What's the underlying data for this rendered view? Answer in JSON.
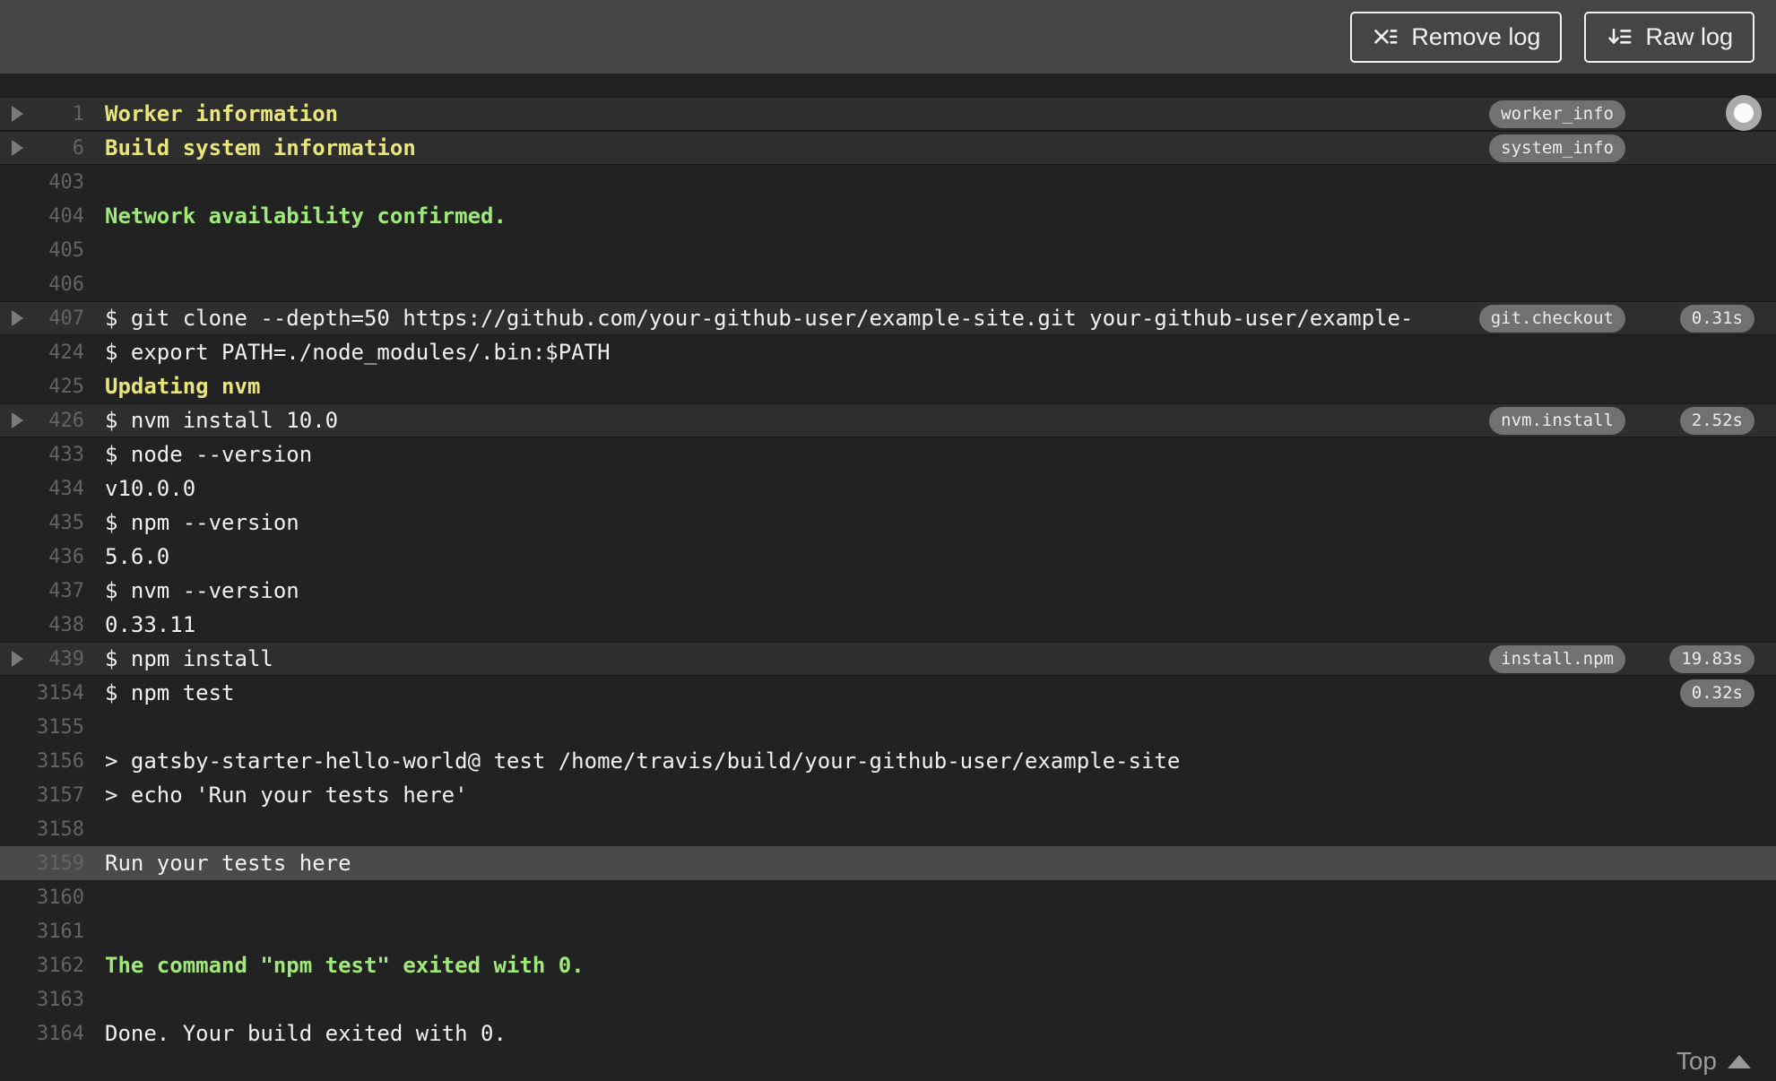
{
  "toolbar": {
    "remove_log_label": "Remove log",
    "raw_log_label": "Raw log"
  },
  "footer": {
    "top_label": "Top"
  },
  "colors": {
    "header_bg": "#454545",
    "log_bg": "#222222",
    "fold_bg": "#2e2e2e",
    "highlight_bg": "#4a4a4a",
    "text": "#f1f1ef",
    "yellow": "#e9e57e",
    "green": "#a0e87a",
    "line_number": "#646464",
    "badge_bg": "#717171",
    "badge_text": "#ececec"
  },
  "log": {
    "rows": [
      {
        "num": "1",
        "text": "Worker information",
        "color": "yellow",
        "bold": true,
        "fold": true,
        "badge": "worker_info",
        "duration": null,
        "highlight": false
      },
      {
        "num": "6",
        "text": "Build system information",
        "color": "yellow",
        "bold": true,
        "fold": true,
        "badge": "system_info",
        "duration": null,
        "highlight": false
      },
      {
        "num": "403",
        "text": "",
        "color": "plain",
        "bold": false,
        "fold": false,
        "badge": null,
        "duration": null,
        "highlight": false
      },
      {
        "num": "404",
        "text": "Network availability confirmed.",
        "color": "green",
        "bold": true,
        "fold": false,
        "badge": null,
        "duration": null,
        "highlight": false
      },
      {
        "num": "405",
        "text": "",
        "color": "plain",
        "bold": false,
        "fold": false,
        "badge": null,
        "duration": null,
        "highlight": false
      },
      {
        "num": "406",
        "text": "",
        "color": "plain",
        "bold": false,
        "fold": false,
        "badge": null,
        "duration": null,
        "highlight": false
      },
      {
        "num": "407",
        "text": "$ git clone --depth=50 https://github.com/your-github-user/example-site.git your-github-user/example-",
        "color": "plain",
        "bold": false,
        "fold": true,
        "badge": "git.checkout",
        "duration": "0.31s",
        "highlight": false
      },
      {
        "num": "424",
        "text": "$ export PATH=./node_modules/.bin:$PATH",
        "color": "plain",
        "bold": false,
        "fold": false,
        "badge": null,
        "duration": null,
        "highlight": false
      },
      {
        "num": "425",
        "text": "Updating nvm",
        "color": "yellow",
        "bold": true,
        "fold": false,
        "badge": null,
        "duration": null,
        "highlight": false
      },
      {
        "num": "426",
        "text": "$ nvm install 10.0",
        "color": "plain",
        "bold": false,
        "fold": true,
        "badge": "nvm.install",
        "duration": "2.52s",
        "highlight": false
      },
      {
        "num": "433",
        "text": "$ node --version",
        "color": "plain",
        "bold": false,
        "fold": false,
        "badge": null,
        "duration": null,
        "highlight": false
      },
      {
        "num": "434",
        "text": "v10.0.0",
        "color": "plain",
        "bold": false,
        "fold": false,
        "badge": null,
        "duration": null,
        "highlight": false
      },
      {
        "num": "435",
        "text": "$ npm --version",
        "color": "plain",
        "bold": false,
        "fold": false,
        "badge": null,
        "duration": null,
        "highlight": false
      },
      {
        "num": "436",
        "text": "5.6.0",
        "color": "plain",
        "bold": false,
        "fold": false,
        "badge": null,
        "duration": null,
        "highlight": false
      },
      {
        "num": "437",
        "text": "$ nvm --version",
        "color": "plain",
        "bold": false,
        "fold": false,
        "badge": null,
        "duration": null,
        "highlight": false
      },
      {
        "num": "438",
        "text": "0.33.11",
        "color": "plain",
        "bold": false,
        "fold": false,
        "badge": null,
        "duration": null,
        "highlight": false
      },
      {
        "num": "439",
        "text": "$ npm install",
        "color": "plain",
        "bold": false,
        "fold": true,
        "badge": "install.npm",
        "duration": "19.83s",
        "highlight": false
      },
      {
        "num": "3154",
        "text": "$ npm test",
        "color": "plain",
        "bold": false,
        "fold": false,
        "badge": null,
        "duration": "0.32s",
        "highlight": false
      },
      {
        "num": "3155",
        "text": "",
        "color": "plain",
        "bold": false,
        "fold": false,
        "badge": null,
        "duration": null,
        "highlight": false
      },
      {
        "num": "3156",
        "text": "> gatsby-starter-hello-world@ test /home/travis/build/your-github-user/example-site",
        "color": "plain",
        "bold": false,
        "fold": false,
        "badge": null,
        "duration": null,
        "highlight": false
      },
      {
        "num": "3157",
        "text": "> echo 'Run your tests here'",
        "color": "plain",
        "bold": false,
        "fold": false,
        "badge": null,
        "duration": null,
        "highlight": false
      },
      {
        "num": "3158",
        "text": "",
        "color": "plain",
        "bold": false,
        "fold": false,
        "badge": null,
        "duration": null,
        "highlight": false
      },
      {
        "num": "3159",
        "text": "Run your tests here",
        "color": "plain",
        "bold": false,
        "fold": false,
        "badge": null,
        "duration": null,
        "highlight": true
      },
      {
        "num": "3160",
        "text": "",
        "color": "plain",
        "bold": false,
        "fold": false,
        "badge": null,
        "duration": null,
        "highlight": false
      },
      {
        "num": "3161",
        "text": "",
        "color": "plain",
        "bold": false,
        "fold": false,
        "badge": null,
        "duration": null,
        "highlight": false
      },
      {
        "num": "3162",
        "text": "The command \"npm test\" exited with 0.",
        "color": "green",
        "bold": true,
        "fold": false,
        "badge": null,
        "duration": null,
        "highlight": false
      },
      {
        "num": "3163",
        "text": "",
        "color": "plain",
        "bold": false,
        "fold": false,
        "badge": null,
        "duration": null,
        "highlight": false
      },
      {
        "num": "3164",
        "text": "Done. Your build exited with 0.",
        "color": "plain",
        "bold": false,
        "fold": false,
        "badge": null,
        "duration": null,
        "highlight": false
      }
    ]
  }
}
